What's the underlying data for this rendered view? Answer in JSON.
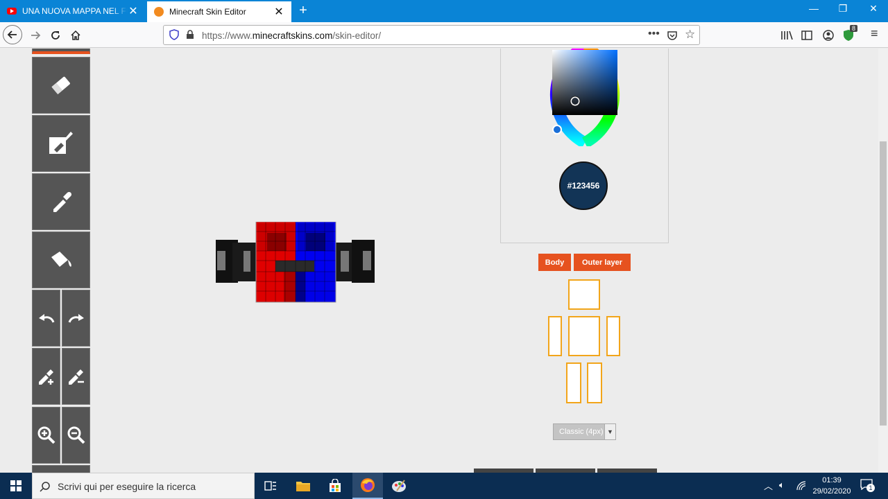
{
  "browser": {
    "tabs": [
      {
        "title": "UNA NUOVA MAPPA NEL FUTU",
        "icon": "youtube-icon",
        "active": false
      },
      {
        "title": "Minecraft Skin Editor",
        "icon": "minecraft-skins-icon",
        "active": true
      }
    ],
    "url_prefix": "https://www.",
    "url_domain": "minecraftskins.com",
    "url_path": "/skin-editor/",
    "extension_badge": "8"
  },
  "editor": {
    "color_hex": "#123456",
    "layer_buttons": [
      "Body",
      "Outer layer"
    ],
    "model_select": "Classic (4px)",
    "accent_color": "#e6521f",
    "part_border_color": "#f2a51a"
  },
  "taskbar": {
    "search_placeholder": "Scrivi qui per eseguire la ricerca",
    "time": "01:39",
    "date": "29/02/2020",
    "notification_count": "1"
  }
}
